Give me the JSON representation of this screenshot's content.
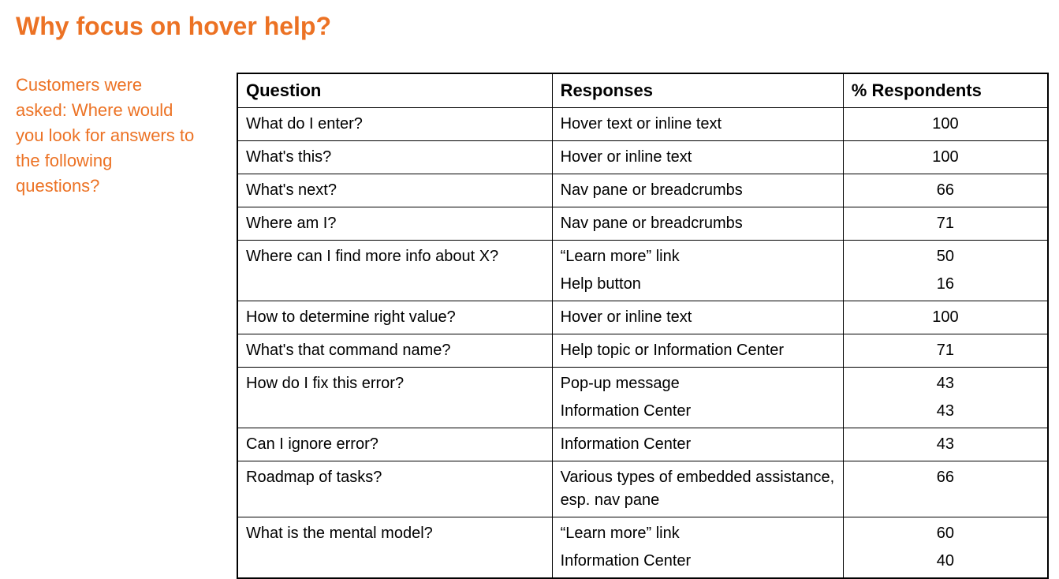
{
  "title": "Why focus on hover help?",
  "sidebarText": "Customers were asked: Where would you look for answers to the following questions?",
  "headers": {
    "question": "Question",
    "responses": "Responses",
    "percent": "% Respondents"
  },
  "rows": [
    {
      "top": true,
      "question": "What do I enter?",
      "response": "Hover text or inline text",
      "percent": "100"
    },
    {
      "top": true,
      "question": "What's this?",
      "response": "Hover or inline text",
      "percent": "100"
    },
    {
      "top": true,
      "question": "What's next?",
      "response": "Nav pane or breadcrumbs",
      "percent": "66"
    },
    {
      "top": true,
      "question": "Where am I?",
      "response": "Nav pane or breadcrumbs",
      "percent": "71"
    },
    {
      "top": true,
      "question": "Where can I find more info about X?",
      "response": "“Learn more” link",
      "percent": "50"
    },
    {
      "top": false,
      "question": "",
      "response": "Help button",
      "percent": "16"
    },
    {
      "top": true,
      "question": "How to determine right value?",
      "response": "Hover or inline text",
      "percent": "100"
    },
    {
      "top": true,
      "question": "What's that command name?",
      "response": "Help topic or Information Center",
      "percent": "71"
    },
    {
      "top": true,
      "question": "How do I fix this error?",
      "response": "Pop-up message",
      "percent": "43"
    },
    {
      "top": false,
      "question": "",
      "response": "Information Center",
      "percent": "43"
    },
    {
      "top": true,
      "question": "Can I ignore error?",
      "response": "Information Center",
      "percent": "43"
    },
    {
      "top": true,
      "question": "Roadmap of tasks?",
      "response": "Various types of embedded assistance, esp. nav pane",
      "percent": "66"
    },
    {
      "top": true,
      "question": "What is the mental model?",
      "response": "“Learn more” link",
      "percent": "60"
    },
    {
      "top": false,
      "question": "",
      "response": "Information Center",
      "percent": "40"
    }
  ],
  "chart_data": {
    "type": "table",
    "title": "Why focus on hover help?",
    "columns": [
      "Question",
      "Responses",
      "% Respondents"
    ],
    "data": [
      {
        "question": "What do I enter?",
        "responses": [
          {
            "label": "Hover text or inline text",
            "percent": 100
          }
        ]
      },
      {
        "question": "What's this?",
        "responses": [
          {
            "label": "Hover or inline text",
            "percent": 100
          }
        ]
      },
      {
        "question": "What's next?",
        "responses": [
          {
            "label": "Nav pane or breadcrumbs",
            "percent": 66
          }
        ]
      },
      {
        "question": "Where am I?",
        "responses": [
          {
            "label": "Nav pane or breadcrumbs",
            "percent": 71
          }
        ]
      },
      {
        "question": "Where can I find more info about X?",
        "responses": [
          {
            "label": "\"Learn more\" link",
            "percent": 50
          },
          {
            "label": "Help button",
            "percent": 16
          }
        ]
      },
      {
        "question": "How to determine right value?",
        "responses": [
          {
            "label": "Hover or inline text",
            "percent": 100
          }
        ]
      },
      {
        "question": "What's that command name?",
        "responses": [
          {
            "label": "Help topic or Information Center",
            "percent": 71
          }
        ]
      },
      {
        "question": "How do I fix this error?",
        "responses": [
          {
            "label": "Pop-up message",
            "percent": 43
          },
          {
            "label": "Information Center",
            "percent": 43
          }
        ]
      },
      {
        "question": "Can I ignore error?",
        "responses": [
          {
            "label": "Information Center",
            "percent": 43
          }
        ]
      },
      {
        "question": "Roadmap of tasks?",
        "responses": [
          {
            "label": "Various types of embedded assistance, esp. nav pane",
            "percent": 66
          }
        ]
      },
      {
        "question": "What is the mental model?",
        "responses": [
          {
            "label": "\"Learn more\" link",
            "percent": 60
          },
          {
            "label": "Information Center",
            "percent": 40
          }
        ]
      }
    ]
  }
}
